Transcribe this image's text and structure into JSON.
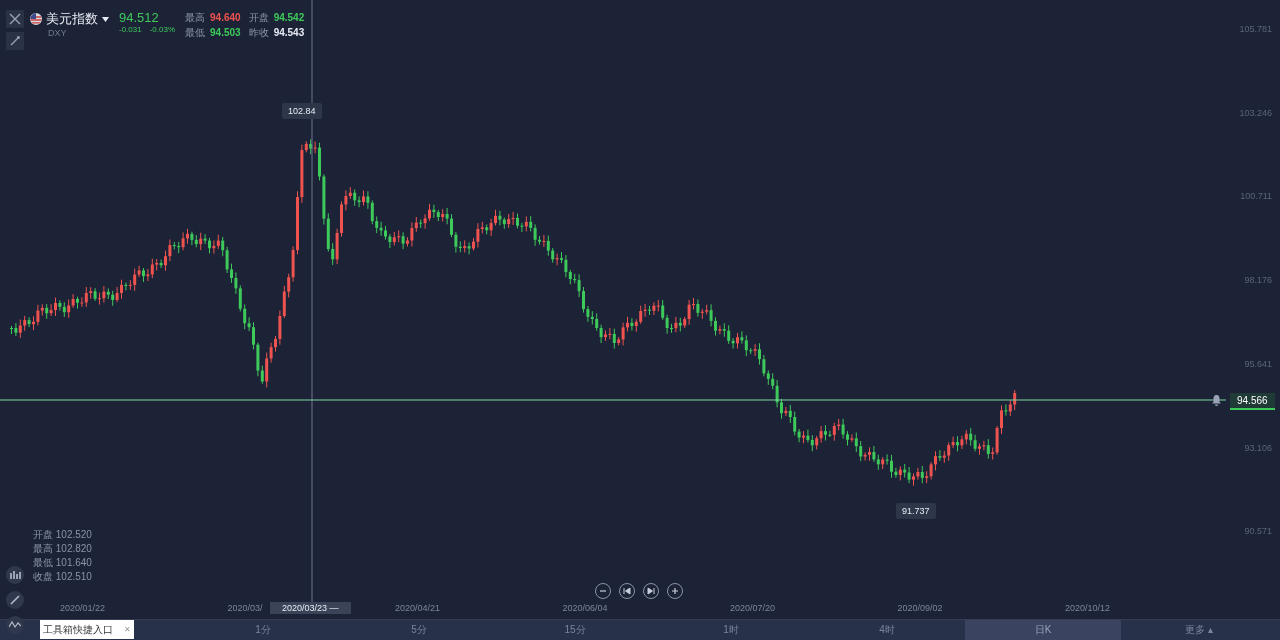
{
  "quote": {
    "name": "美元指数",
    "symbol": "DXY",
    "price": "94.512",
    "change": "-0.031",
    "change_pct": "-0.03%",
    "color": "#3ec95b",
    "stats": [
      {
        "label": "最高",
        "value": "94.640",
        "color": "#ef5350"
      },
      {
        "label": "开盘",
        "value": "94.542",
        "color": "#3ec95b"
      },
      {
        "label": "最低",
        "value": "94.503",
        "color": "#3ec95b"
      },
      {
        "label": "昨收",
        "value": "94.543",
        "color": "#e8ecf4"
      }
    ]
  },
  "price_axis": [
    "105.781",
    "103.246",
    "100.711",
    "98.176",
    "95.641",
    "93.106",
    "90.571"
  ],
  "date_axis": [
    "2020/01/22",
    "2020/03/",
    "2020/04/21",
    "2020/06/04",
    "2020/07/20",
    "2020/09/02",
    "2020/10/12"
  ],
  "crosshair_date": "2020/03/23 —",
  "current_price": "94.566",
  "high_marker": "102.84",
  "low_marker": "91.737",
  "ohlc": [
    {
      "label": "开盘",
      "value": "102.520"
    },
    {
      "label": "最高",
      "value": "102.820"
    },
    {
      "label": "最低",
      "value": "101.640"
    },
    {
      "label": "收盘",
      "value": "102.510"
    }
  ],
  "periods": [
    {
      "label": "1分",
      "selected": false
    },
    {
      "label": "5分",
      "selected": false
    },
    {
      "label": "15分",
      "selected": false
    },
    {
      "label": "1时",
      "selected": false
    },
    {
      "label": "4时",
      "selected": false
    },
    {
      "label": "日K",
      "selected": true
    },
    {
      "label": "更多 ▴",
      "selected": false
    }
  ],
  "tooltip": {
    "text": "工具箱快捷入口",
    "close": "✕"
  }
}
